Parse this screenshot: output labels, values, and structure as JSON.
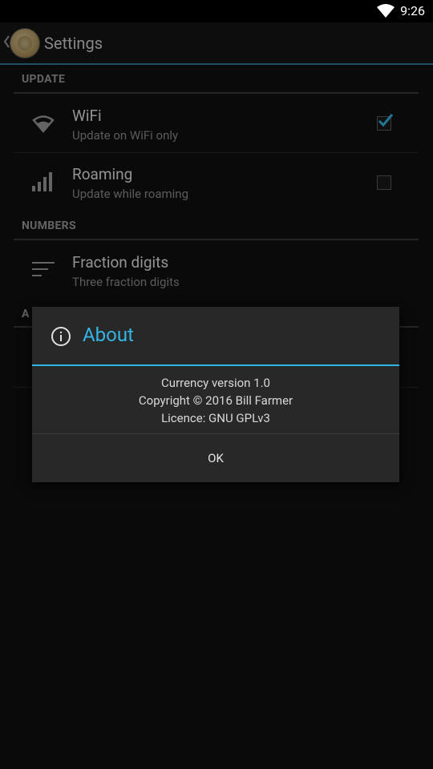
{
  "status_bar": {
    "time": "9:26",
    "wifi_icon": "wifi-icon"
  },
  "action_bar": {
    "title": "Settings",
    "up_icon": "chevron-left-icon",
    "app_icon": "coin-icon"
  },
  "sections": [
    {
      "header": "UPDATE",
      "items": [
        {
          "title": "WiFi",
          "summary": "Update on WiFi only",
          "icon": "wifi-icon",
          "checked": true
        },
        {
          "title": "Roaming",
          "summary": "Update while roaming",
          "icon": "signal-bars-icon",
          "checked": false
        }
      ]
    },
    {
      "header": "NUMBERS",
      "items": [
        {
          "title": "Fraction digits",
          "summary": "Three fraction digits",
          "icon": "sort-lines-icon"
        }
      ]
    },
    {
      "header": "A"
    }
  ],
  "dialog": {
    "title": "About",
    "icon": "info-icon",
    "message_lines": [
      "Currency version 1.0",
      "Copyright © 2016 Bill Farmer",
      "Licence: GNU GPLv3"
    ],
    "ok_label": "OK"
  },
  "colors": {
    "accent": "#33b5e5",
    "background": "#101010",
    "dialog": "#282828"
  }
}
